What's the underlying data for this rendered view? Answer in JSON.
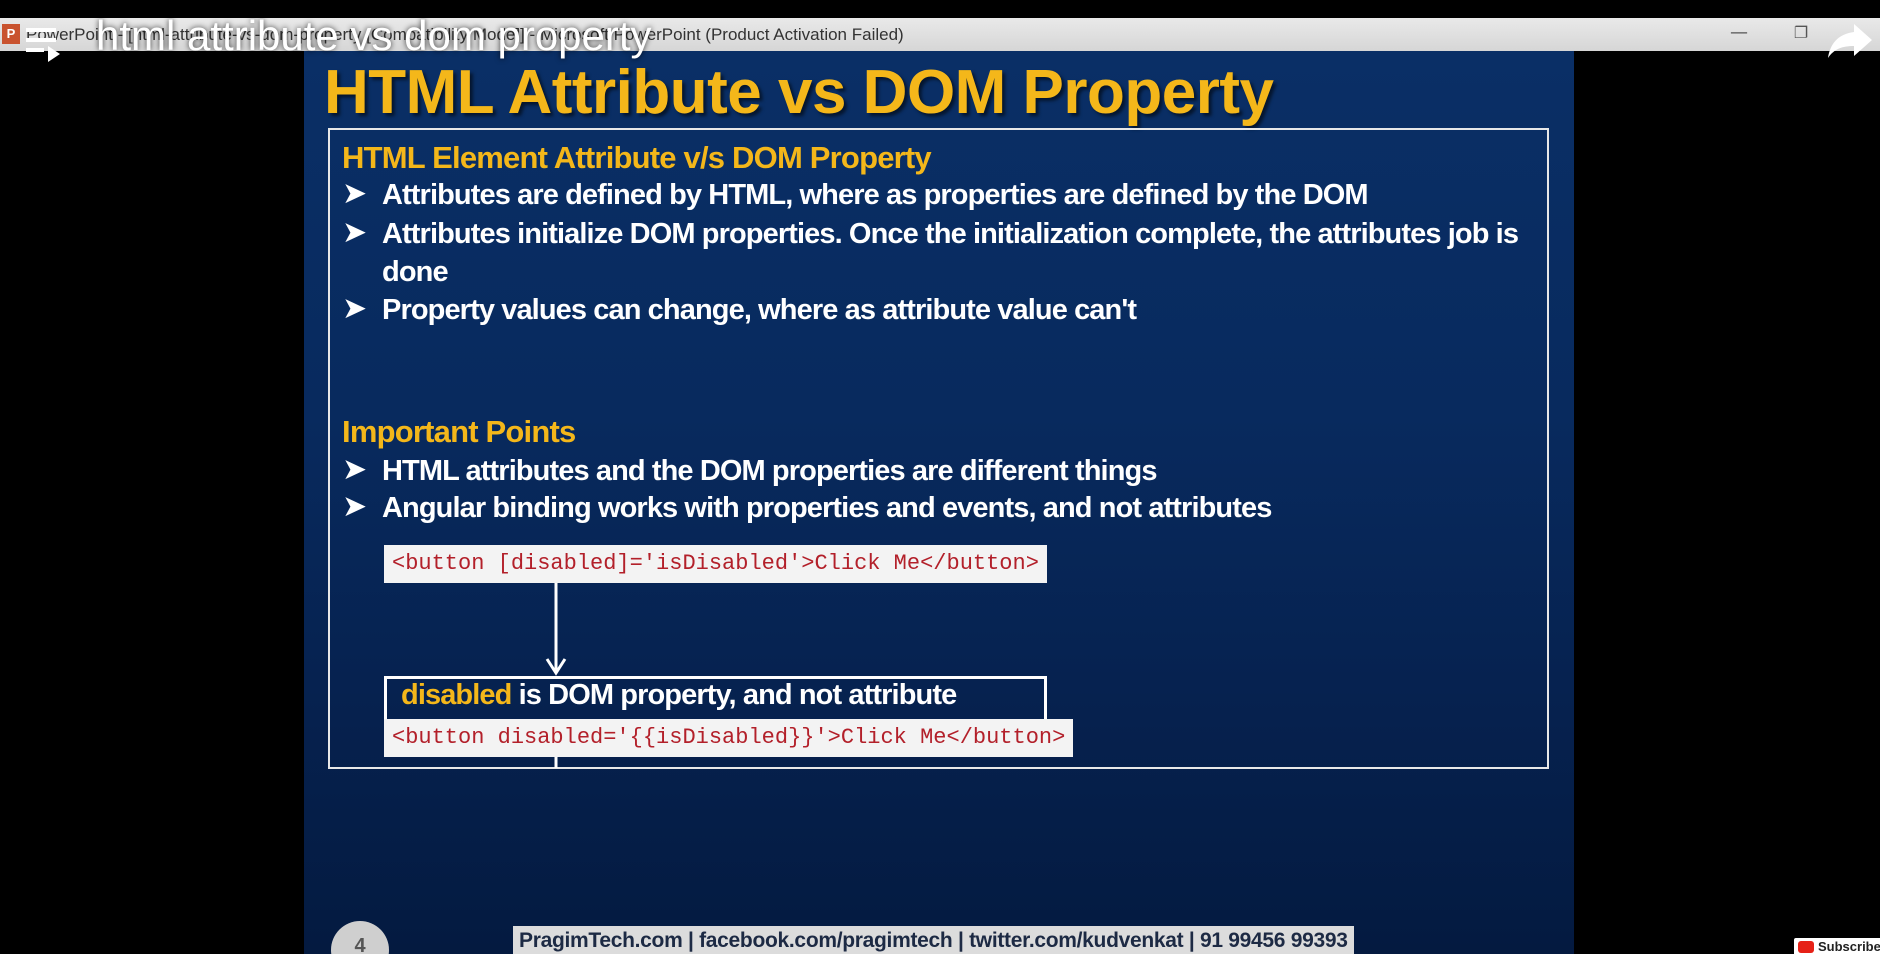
{
  "ppt_window": {
    "app_icon_letter": "P",
    "title": "PowerPoint - [html-attribute-vs-dom-property [Compatibility Mode]] - Microsoft PowerPoint (Product Activation Failed)"
  },
  "video_overlay": {
    "title": "html attribute vs dom property"
  },
  "slide": {
    "title": "HTML Attribute vs DOM Property",
    "section1": {
      "heading": "HTML Element Attribute v/s DOM Property",
      "bullets": [
        "Attributes are defined by HTML, where as properties are defined by the DOM",
        "Attributes initialize DOM properties. Once the initialization complete, the attributes job is done",
        "Property values can change, where as attribute value can't"
      ]
    },
    "section2": {
      "heading": "Important Points",
      "bullets": [
        "HTML attributes and the DOM properties are different things",
        "Angular binding works with properties and events, and not attributes"
      ]
    },
    "diagram": {
      "code_top": "<button [disabled]='isDisabled'>Click Me</button>",
      "callout_keyword": "disabled",
      "callout_rest": " is DOM property, and not attribute",
      "code_bottom": "<button disabled='{{isDisabled}}'>Click Me</button>"
    },
    "slide_number": "4",
    "footer": "PragimTech.com | facebook.com/pragimtech | twitter.com/kudvenkat | 91 99456 99393"
  },
  "subscribe": {
    "label": "Subscribe"
  },
  "colors": {
    "accent_gold": "#f4b71a",
    "code_red": "#b3202a",
    "slide_blue": "#082a5e"
  },
  "icons": {
    "playlist": "playlist-icon",
    "share": "share-icon",
    "bullet": "arrow-bullet-icon",
    "minimize": "minimize-icon",
    "restore": "restore-icon"
  }
}
